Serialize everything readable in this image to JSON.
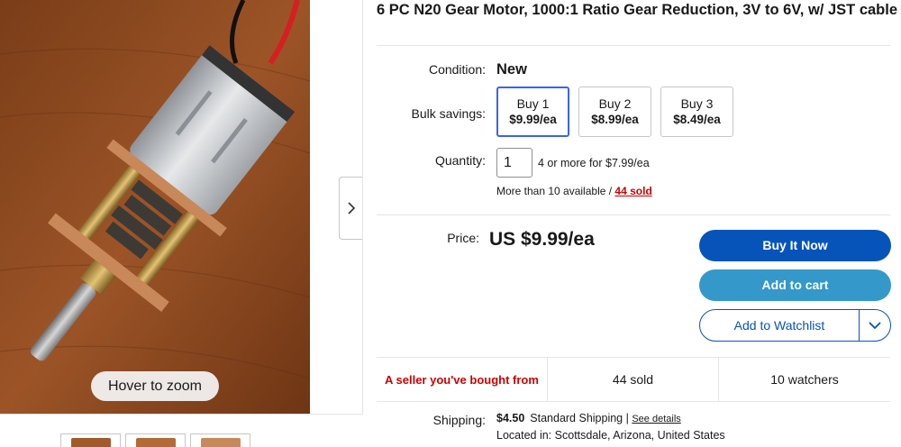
{
  "gallery": {
    "zoom_hint": "Hover to zoom",
    "thumbnail_count": 3
  },
  "listing": {
    "title": "6 PC  N20 Gear Motor, 1000:1 Ratio Gear Reduction, 3V to 6V, w/ JST cable",
    "condition_label": "Condition:",
    "condition_value": "New",
    "bulk_label": "Bulk savings:",
    "bulk_options": [
      {
        "label": "Buy 1",
        "price": "$9.99/ea",
        "selected": true
      },
      {
        "label": "Buy 2",
        "price": "$8.99/ea",
        "selected": false
      },
      {
        "label": "Buy 3",
        "price": "$8.49/ea",
        "selected": false
      }
    ],
    "quantity_label": "Quantity:",
    "quantity_value": "1",
    "quantity_note": "4 or more for $7.99/ea",
    "availability_text": "More than 10 available / ",
    "sold_link": "44 sold",
    "price_label": "Price:",
    "price_value": "US $9.99/ea"
  },
  "actions": {
    "buy_now": "Buy It Now",
    "add_to_cart": "Add to cart",
    "watchlist": "Add to Watchlist"
  },
  "stats": {
    "seller_note": "A seller you've bought from",
    "sold": "44 sold",
    "watchers": "10 watchers"
  },
  "shipping": {
    "label": "Shipping:",
    "cost": "$4.50",
    "method": "Standard Shipping",
    "pipe": " | ",
    "details_link": "See details",
    "location_label": "Located in:",
    "location_value": "Scottsdale, Arizona, United States"
  },
  "colors": {
    "buy_now": "#0654ba",
    "add_to_cart": "#3498ca",
    "selected_option_border": "#3665f3",
    "seller_note": "#cc0000",
    "sold_link": "#cc0000"
  },
  "icons": {
    "gallery_next": "chevron-right-icon",
    "watchlist_menu": "chevron-down-icon"
  }
}
